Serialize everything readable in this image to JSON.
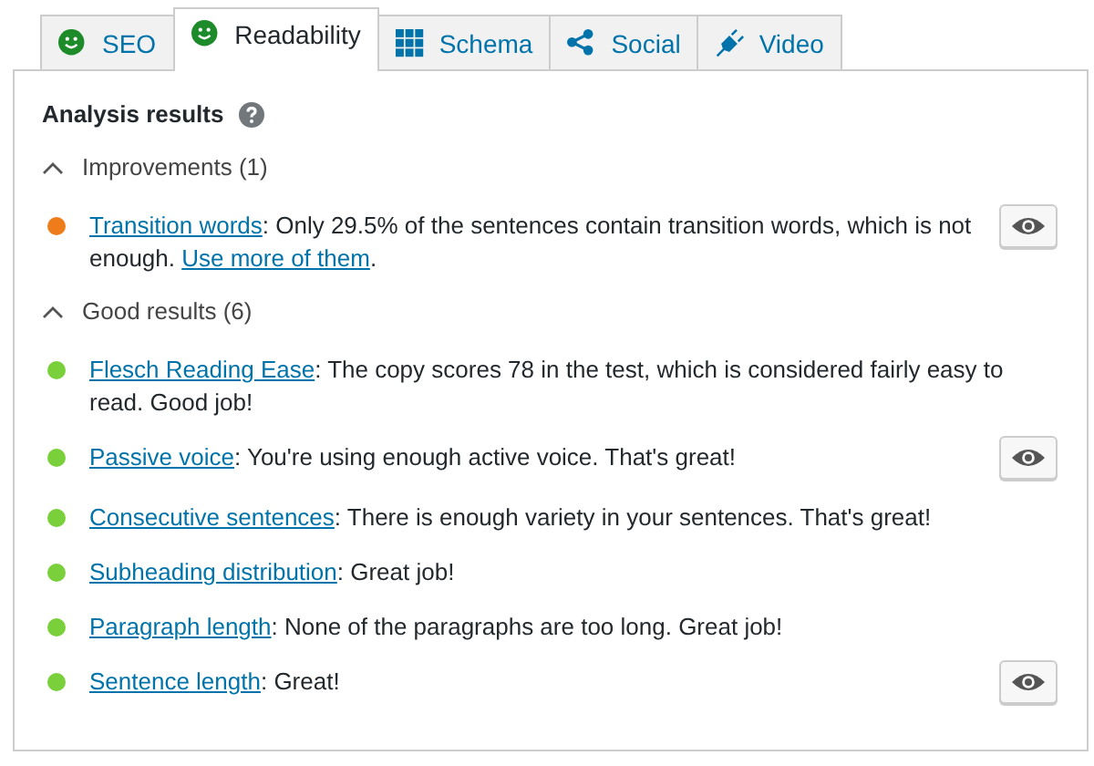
{
  "tabs": [
    {
      "label": "SEO",
      "selected": false
    },
    {
      "label": "Readability",
      "selected": true
    },
    {
      "label": "Schema",
      "selected": false
    },
    {
      "label": "Social",
      "selected": false
    },
    {
      "label": "Video",
      "selected": false
    }
  ],
  "heading": "Analysis results",
  "groups": [
    {
      "title": "Improvements (1)",
      "expanded": true,
      "results": [
        {
          "color": "#ee7c1b",
          "marker_button": true,
          "parts": [
            {
              "kind": "link",
              "text": "Transition words"
            },
            {
              "kind": "text",
              "text": ": Only 29.5% of the sentences contain transition words, which is not enough. "
            },
            {
              "kind": "link",
              "text": "Use more of them"
            },
            {
              "kind": "text",
              "text": "."
            }
          ]
        }
      ]
    },
    {
      "title": "Good results (6)",
      "expanded": true,
      "results": [
        {
          "color": "#7ad03a",
          "marker_button": false,
          "parts": [
            {
              "kind": "link",
              "text": "Flesch Reading Ease"
            },
            {
              "kind": "text",
              "text": ": The copy scores 78 in the test, which is considered fairly easy to read. Good job!"
            }
          ]
        },
        {
          "color": "#7ad03a",
          "marker_button": true,
          "parts": [
            {
              "kind": "link",
              "text": "Passive voice"
            },
            {
              "kind": "text",
              "text": ": You're using enough active voice. That's great!"
            }
          ]
        },
        {
          "color": "#7ad03a",
          "marker_button": false,
          "parts": [
            {
              "kind": "link",
              "text": "Consecutive sentences"
            },
            {
              "kind": "text",
              "text": ": There is enough variety in your sentences. That's great!"
            }
          ]
        },
        {
          "color": "#7ad03a",
          "marker_button": false,
          "parts": [
            {
              "kind": "link",
              "text": "Subheading distribution"
            },
            {
              "kind": "text",
              "text": ": Great job!"
            }
          ]
        },
        {
          "color": "#7ad03a",
          "marker_button": false,
          "parts": [
            {
              "kind": "link",
              "text": "Paragraph length"
            },
            {
              "kind": "text",
              "text": ": None of the paragraphs are too long. Great job!"
            }
          ]
        },
        {
          "color": "#7ad03a",
          "marker_button": true,
          "parts": [
            {
              "kind": "link",
              "text": "Sentence length"
            },
            {
              "kind": "text",
              "text": ": Great!"
            }
          ]
        }
      ]
    }
  ]
}
